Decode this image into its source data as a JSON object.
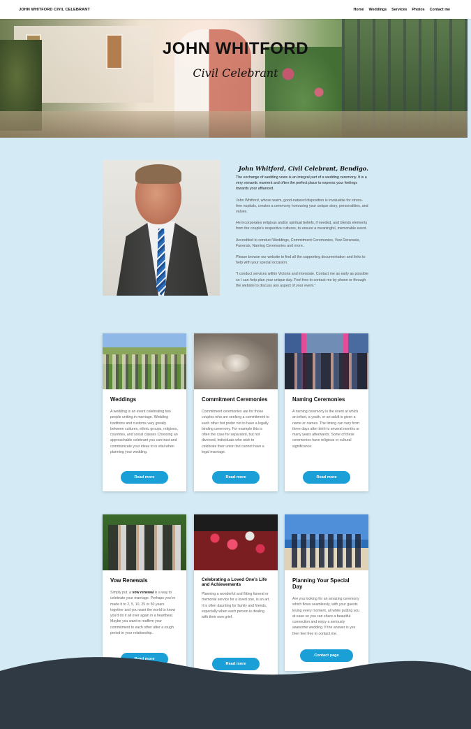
{
  "nav": {
    "brand": "JOHN WHITFORD CIVIL CELEBRANT",
    "items": [
      "Home",
      "Weddings",
      "Services",
      "Photos",
      "Contact me"
    ]
  },
  "hero": {
    "title": "JOHN WHITFORD",
    "subtitle": "Civil Celebrant"
  },
  "bio": {
    "heading": "John Whitford, Civil Celebrant, Bendigo.",
    "paragraphs": [
      "The exchange of wedding vows is an integral part of a wedding ceremony. It is a very romantic moment and often the perfect place to express your feelings towards your affianced.",
      "John Whitford, whose warm, good-natured disposition is invaluable for stress-free nuptials, creates a ceremony honouring your unique story, personalities, and values.",
      "He incorporates religious and/or spiritual beliefs, if needed, and blends elements from the couple's respective cultures, to ensure a meaningful, memorable event.",
      "Accredited to conduct Weddings, Commitment Ceremonies, Vow Renewals, Funerals, Naming Ceremonies and more..",
      "Please browse our website to find all the supporting documentation and links to help with your special occasion.",
      "\"I conduct services within Victoria and interstate. Contact me as early as possible so I can help plan your unique day. Feel free to contact me by phone or through the website to discuss any aspect of your event.\""
    ]
  },
  "cards": [
    {
      "title": "Weddings",
      "text": "A wedding is an event celebrating two people uniting in marriage. Wedding traditions and customs vary greatly between cultures, ethnic groups, religions, countries, and social classes Choosing an approachable celebrant you can trust and communicate your ideas to is vital when planning your wedding.",
      "button": "Read more"
    },
    {
      "title": "Commitment Ceremonies",
      "text": "Commitment ceremonies are for those couples who are seeking a commitment to each other but prefer not to have a legally binding ceremony. For example this is often the case for separated, but not divorced, individuals who wish to celebrate their union but cannot have a legal marriage.",
      "button": "Read more"
    },
    {
      "title": "Naming Ceremonies",
      "text": "A naming ceremony is the event at which an infant, a youth, or an adult is given a name or names. The timing can vary from three days after birth to several months or many years afterwards. Some of these ceremonies have religious or cultural significance.",
      "button": "Read more"
    },
    {
      "title": "Vow Renewals",
      "text_before": "Simply put, a ",
      "text_bold": "vow renewal",
      "text_after": " is a way to celebrate your marriage. Perhaps you've made it to 2, 5, 10, 25 or 50 years together and you want the world to know you'd do it all over again in a heartbeat. Maybe you want to reaffirm your commitment to each other after a rough period in your relationship..",
      "button": "Read more"
    },
    {
      "title": "Celebrating a Loved One's Life and Achievements",
      "text": "Planning a wonderful and fitting funeral or memorial service for a loved one, is an art.  It is often daunting for family and friends, especially when each person is dealing with their own grief.",
      "button": "Read more"
    },
    {
      "title": "Planning Your Special Day",
      "text": "Are you looking for an amazing ceremony which flows seamlessly, with your guests loving every moment, all while putting you at ease so you can share a beautiful connection and enjoy a seriously awesome wedding. If the answer is yes then feel free to contact me.",
      "button": "Contact page"
    }
  ],
  "colors": {
    "accent": "#1b9fd7",
    "background": "#d4eaf4",
    "footer": "#2f3a44"
  }
}
